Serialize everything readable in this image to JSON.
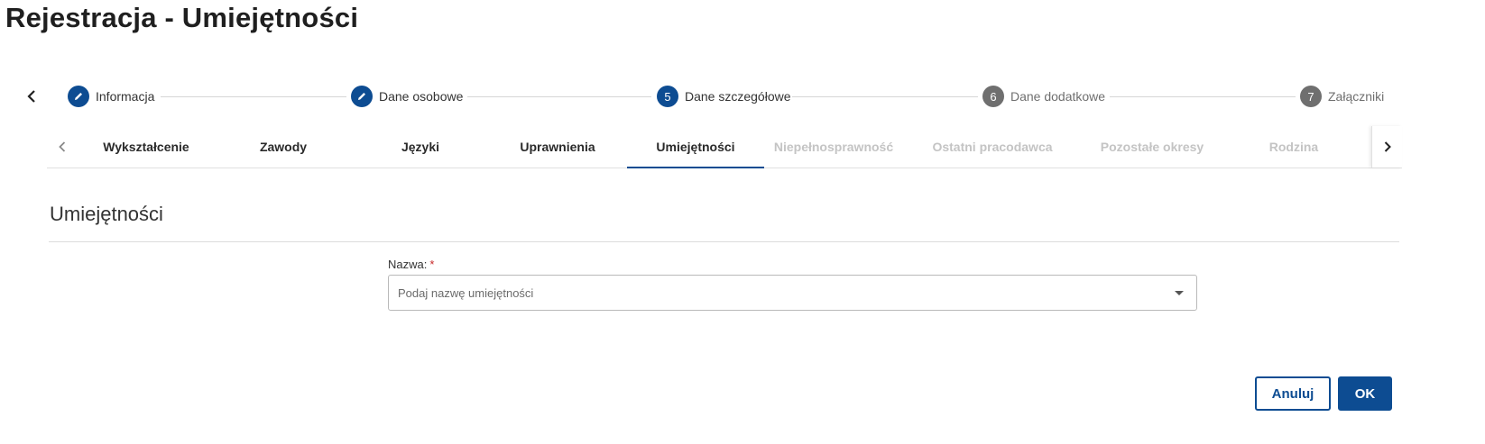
{
  "page": {
    "title": "Rejestracja - Umiejętności"
  },
  "stepper": {
    "steps": [
      {
        "label": "Informacja",
        "status": "done",
        "icon": "pencil-icon"
      },
      {
        "label": "Dane osobowe",
        "status": "done",
        "icon": "pencil-icon"
      },
      {
        "number": "5",
        "label": "Dane szczegółowe",
        "status": "active"
      },
      {
        "number": "6",
        "label": "Dane dodatkowe",
        "status": "todo"
      },
      {
        "number": "7",
        "label": "Załączniki",
        "status": "todo"
      }
    ]
  },
  "tabs": {
    "items": [
      {
        "label": "Wykształcenie",
        "state": "enabled"
      },
      {
        "label": "Zawody",
        "state": "enabled"
      },
      {
        "label": "Języki",
        "state": "enabled"
      },
      {
        "label": "Uprawnienia",
        "state": "enabled"
      },
      {
        "label": "Umiejętności",
        "state": "active"
      },
      {
        "label": "Niepełnosprawność",
        "state": "disabled"
      },
      {
        "label": "Ostatni pracodawca",
        "state": "disabled"
      },
      {
        "label": "Pozostałe okresy",
        "state": "disabled"
      },
      {
        "label": "Rodzina",
        "state": "disabled"
      }
    ]
  },
  "section": {
    "title": "Umiejętności",
    "field": {
      "label": "Nazwa:",
      "required_mark": "*",
      "placeholder": "Podaj nazwę umiejętności"
    }
  },
  "actions": {
    "cancel_label": "Anuluj",
    "ok_label": "OK"
  },
  "colors": {
    "primary": "#0d4c92",
    "step_todo": "#6f6f6f",
    "tab_disabled": "#c4c4c4",
    "required": "#c62828"
  }
}
